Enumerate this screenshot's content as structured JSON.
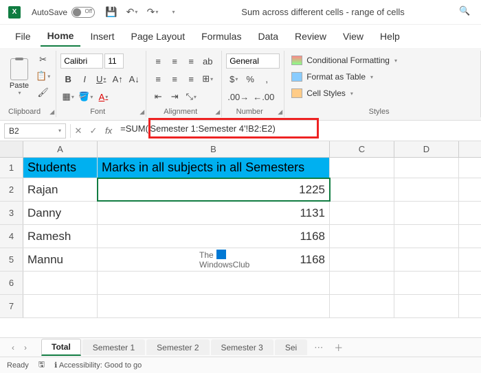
{
  "titlebar": {
    "autosave_label": "AutoSave",
    "autosave_state": "Off",
    "doc_title": "Sum across different cells - range of cells"
  },
  "menubar": {
    "tabs": [
      "File",
      "Home",
      "Insert",
      "Page Layout",
      "Formulas",
      "Data",
      "Review",
      "View",
      "Help"
    ],
    "active_index": 1
  },
  "ribbon": {
    "clipboard": {
      "label": "Clipboard",
      "paste": "Paste"
    },
    "font": {
      "label": "Font",
      "name": "Calibri",
      "size": "11"
    },
    "alignment": {
      "label": "Alignment"
    },
    "number": {
      "label": "Number",
      "format": "General"
    },
    "styles": {
      "label": "Styles",
      "conditional": "Conditional Formatting",
      "table": "Format as Table",
      "cell": "Cell Styles"
    }
  },
  "formula_bar": {
    "cell_ref": "B2",
    "formula": "=SUM('Semester 1:Semester 4'!B2:E2)"
  },
  "grid": {
    "columns": [
      "A",
      "B",
      "C",
      "D"
    ],
    "header_row": {
      "A": "Students",
      "B": "Marks in all subjects in all Semesters"
    },
    "rows": [
      {
        "A": "Rajan",
        "B": "1225"
      },
      {
        "A": "Danny",
        "B": "1131"
      },
      {
        "A": "Ramesh",
        "B": "1168"
      },
      {
        "A": "Mannu",
        "B": "1168"
      }
    ]
  },
  "watermark": {
    "line1": "The",
    "line2": "WindowsClub"
  },
  "sheets": {
    "tabs": [
      "Total",
      "Semester 1",
      "Semester 2",
      "Semester 3",
      "Sei"
    ],
    "active_index": 0
  },
  "statusbar": {
    "mode": "Ready",
    "accessibility": "Accessibility: Good to go"
  }
}
